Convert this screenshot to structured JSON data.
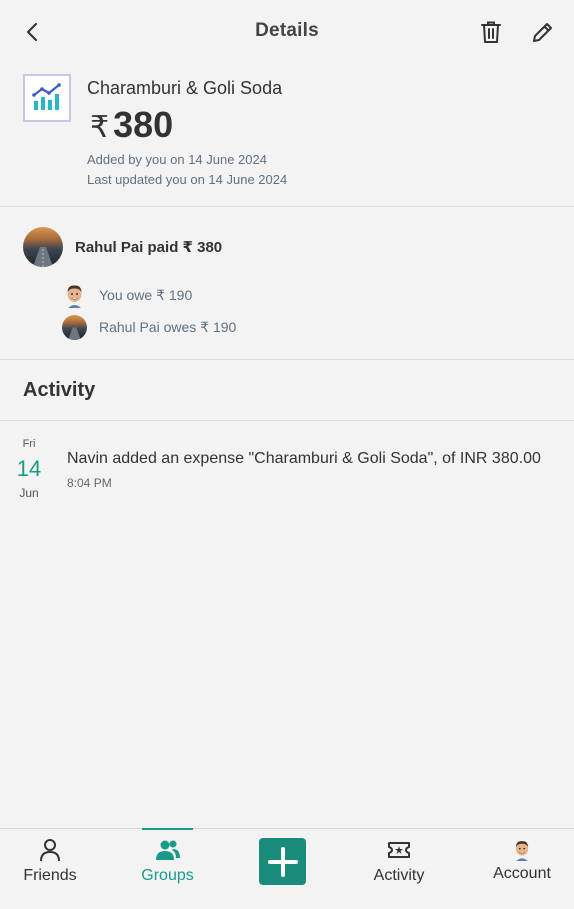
{
  "header": {
    "title": "Details",
    "back_icon": "chevron-left-icon",
    "delete_icon": "trash-icon",
    "edit_icon": "pencil-icon"
  },
  "expense": {
    "title": "Charamburi & Goli Soda",
    "currency_symbol": "₹",
    "amount": "380",
    "added_by": "Added by you on 14 June 2024",
    "updated": "Last updated you on 14 June 2024",
    "category_icon": "chart-icon"
  },
  "split": {
    "payer_text": "Rahul Pai paid ₹ 380",
    "rows": [
      {
        "text": "You owe ₹ 190"
      },
      {
        "text": "Rahul Pai owes ₹ 190"
      }
    ]
  },
  "activity": {
    "title": "Activity",
    "items": [
      {
        "weekday": "Fri",
        "day": "14",
        "month": "Jun",
        "text": "Navin added an expense \"Charamburi & Goli Soda\", of INR 380.00",
        "time": "8:04 PM"
      }
    ]
  },
  "tabs": {
    "friends": "Friends",
    "groups": "Groups",
    "activity": "Activity",
    "account": "Account",
    "active": "groups"
  },
  "colors": {
    "accent": "#1a9b8a",
    "add_button": "#1a8c7c",
    "meta_text": "#5f7182",
    "background": "#f3f3f3"
  }
}
